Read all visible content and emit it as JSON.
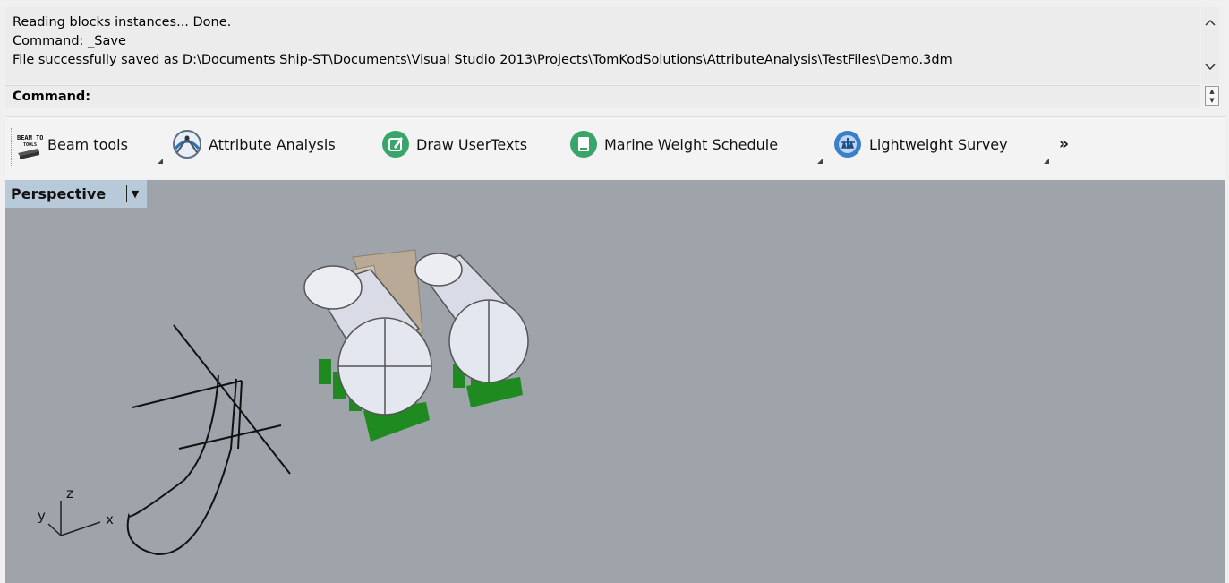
{
  "command_history": {
    "lines": [
      "Reading blocks instances... Done.",
      "Command: _Save",
      "File successfully saved as D:\\Documents Ship-ST\\Documents\\Visual Studio 2013\\Projects\\TomKodSolutions\\AttributeAnalysis\\TestFiles\\Demo.3dm"
    ]
  },
  "command_prompt": {
    "label": "Command:",
    "value": ""
  },
  "toolbar": {
    "items": [
      {
        "label": "Beam tools",
        "icon": "beam-tools-icon",
        "has_flyout": true
      },
      {
        "label": "Attribute Analysis",
        "icon": "attribute-analysis-icon",
        "has_flyout": false
      },
      {
        "label": "Draw UserTexts",
        "icon": "draw-usertexts-icon",
        "has_flyout": false
      },
      {
        "label": "Marine Weight Schedule",
        "icon": "marine-weight-schedule-icon",
        "has_flyout": true
      },
      {
        "label": "Lightweight Survey",
        "icon": "lightweight-survey-icon",
        "has_flyout": true
      }
    ],
    "overflow": "»"
  },
  "viewport": {
    "title": "Perspective",
    "background": "#9ea4aa",
    "axes": {
      "x": "x",
      "y": "y",
      "z": "z"
    },
    "model_colors": {
      "tanks": "#e4e6f0",
      "supports": "#1f8a1f",
      "frame": "#b8aa96",
      "curves": "#111111"
    }
  },
  "icon_beam_label": "BEAM TOOLS"
}
